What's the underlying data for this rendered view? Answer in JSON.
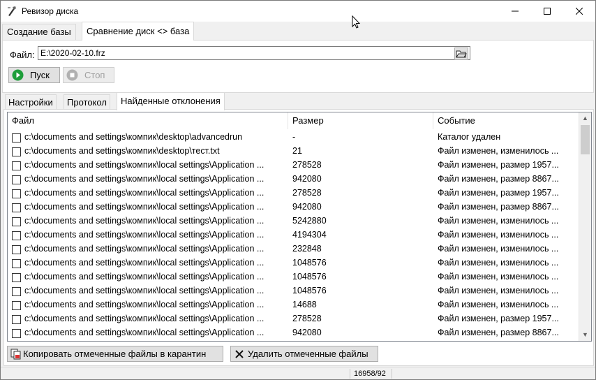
{
  "window": {
    "title": "Ревизор диска",
    "icon": "tool-icon"
  },
  "top_tabs": [
    {
      "label": "Создание базы",
      "active": false
    },
    {
      "label": "Сравнение диск <> база",
      "active": true
    }
  ],
  "file": {
    "label": "Файл:",
    "value": "E:\\2020-02-10.frz",
    "browse_icon": "folder-open-icon"
  },
  "buttons": {
    "start": "Пуск",
    "stop": "Стоп"
  },
  "inner_tabs": [
    {
      "label": "Настройки",
      "active": false
    },
    {
      "label": "Протокол",
      "active": false
    },
    {
      "label": "Найденные отклонения",
      "active": true
    }
  ],
  "table": {
    "columns": [
      "Файл",
      "Размер",
      "Событие"
    ],
    "rows": [
      {
        "file": "c:\\documents and settings\\компик\\desktop\\advancedrun",
        "size": "-",
        "event": "Каталог удален"
      },
      {
        "file": "c:\\documents and settings\\компик\\desktop\\тест.txt",
        "size": "21",
        "event": "Файл изменен, изменилось ..."
      },
      {
        "file": "c:\\documents and settings\\компик\\local settings\\Application ...",
        "size": "278528",
        "event": "Файл изменен, размер 1957..."
      },
      {
        "file": "c:\\documents and settings\\компик\\local settings\\Application ...",
        "size": "942080",
        "event": "Файл изменен, размер 8867..."
      },
      {
        "file": "c:\\documents and settings\\компик\\local settings\\Application ...",
        "size": "278528",
        "event": "Файл изменен, размер 1957..."
      },
      {
        "file": "c:\\documents and settings\\компик\\local settings\\Application ...",
        "size": "942080",
        "event": "Файл изменен, размер 8867..."
      },
      {
        "file": "c:\\documents and settings\\компик\\local settings\\Application ...",
        "size": "5242880",
        "event": "Файл изменен, изменилось ..."
      },
      {
        "file": "c:\\documents and settings\\компик\\local settings\\Application ...",
        "size": "4194304",
        "event": "Файл изменен, изменилось ..."
      },
      {
        "file": "c:\\documents and settings\\компик\\local settings\\Application ...",
        "size": "232848",
        "event": "Файл изменен, изменилось ..."
      },
      {
        "file": "c:\\documents and settings\\компик\\local settings\\Application ...",
        "size": "1048576",
        "event": "Файл изменен, изменилось ..."
      },
      {
        "file": "c:\\documents and settings\\компик\\local settings\\Application ...",
        "size": "1048576",
        "event": "Файл изменен, изменилось ..."
      },
      {
        "file": "c:\\documents and settings\\компик\\local settings\\Application ...",
        "size": "1048576",
        "event": "Файл изменен, изменилось ..."
      },
      {
        "file": "c:\\documents and settings\\компик\\local settings\\Application ...",
        "size": "14688",
        "event": "Файл изменен, изменилось ..."
      },
      {
        "file": "c:\\documents and settings\\компик\\local settings\\Application ...",
        "size": "278528",
        "event": "Файл изменен, размер 1957..."
      },
      {
        "file": "c:\\documents and settings\\компик\\local settings\\Application ...",
        "size": "942080",
        "event": "Файл изменен, размер 8867..."
      }
    ]
  },
  "bottom_buttons": {
    "copy": "Копировать отмеченные файлы в карантин",
    "delete": "Удалить отмеченные файлы"
  },
  "status": {
    "counter": "16958/92"
  },
  "colors": {
    "start_icon": "#1e9e3a",
    "stop_icon": "#b0b0b0"
  }
}
